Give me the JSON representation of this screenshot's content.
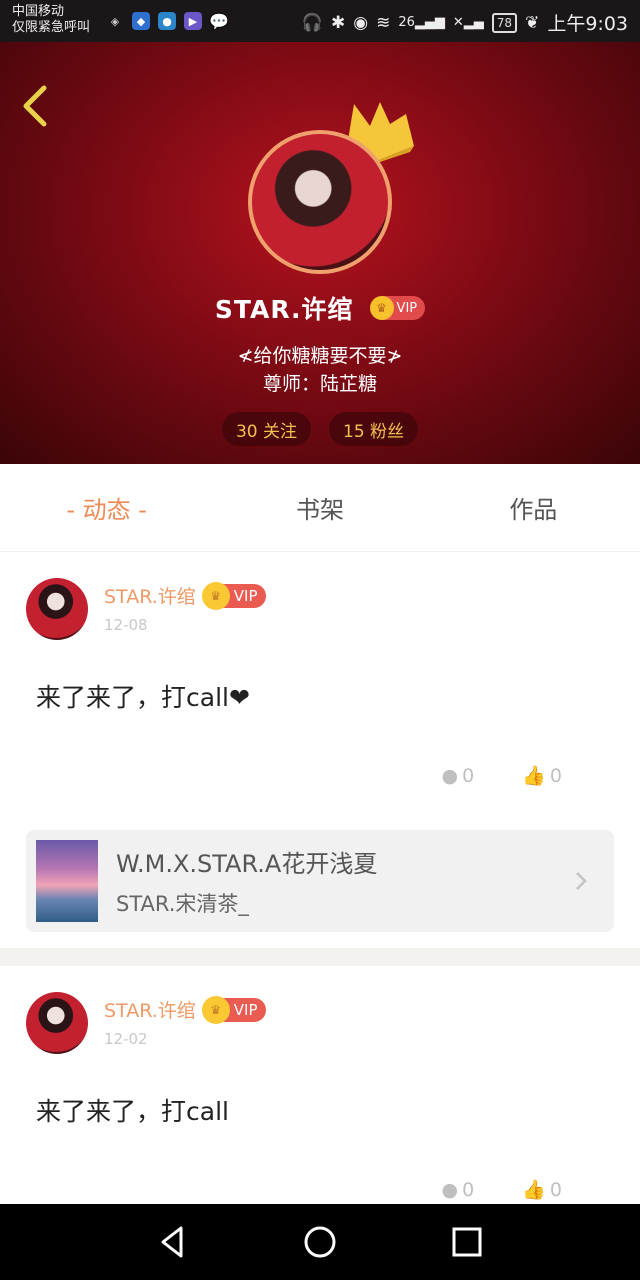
{
  "status_bar": {
    "carrier": "中国移动",
    "emergency": "仅限紧急呼叫",
    "network": "26",
    "battery": "78",
    "time": "上午9:03"
  },
  "profile": {
    "username": "STAR.许绾",
    "vip_label": "VIP",
    "bio_line1": "≮给你糖糖要不要≯",
    "bio_line2": "尊师：陆芷糖",
    "following": "30 关注",
    "followers": "15 粉丝"
  },
  "tabs": [
    {
      "label": "- 动态 -",
      "active": true
    },
    {
      "label": "书架",
      "active": false
    },
    {
      "label": "作品",
      "active": false
    }
  ],
  "posts": [
    {
      "author": "STAR.许绾",
      "vip_label": "VIP",
      "date": "12-08",
      "content": "来了来了，打call❤",
      "comments": "0",
      "likes": "0",
      "shared_book": {
        "title": "W.M.X.STAR.A花开浅夏",
        "author": "STAR.宋清茶_"
      }
    },
    {
      "author": "STAR.许绾",
      "vip_label": "VIP",
      "date": "12-02",
      "content": "来了来了，打call",
      "comments": "0",
      "likes": "0"
    }
  ],
  "colors": {
    "accent": "#ef8a55",
    "vip_red": "#e24b4b",
    "gold": "#f6c12b",
    "header_red": "#b5131e"
  }
}
